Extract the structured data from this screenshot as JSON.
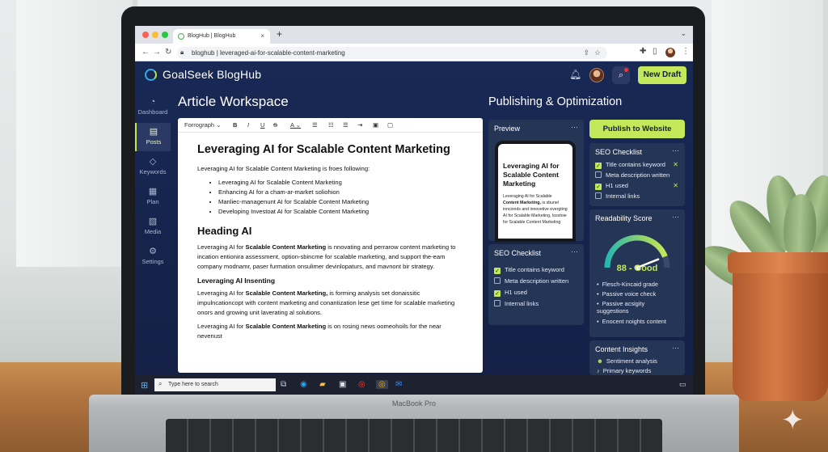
{
  "browser": {
    "tab_title": "BlogHub | BlogHub",
    "tab_close": "×",
    "new_tab": "+",
    "tab_dropdown": "⌄",
    "url": "bloghub | leveraged-ai-for-scalable-content-marketing",
    "nav": {
      "back": "←",
      "forward": "→",
      "reload": "↻"
    },
    "icons": [
      "share-icon",
      "star-icon",
      "extensions-icon",
      "sidebar-icon",
      "profile-avatar",
      "menu-icon"
    ]
  },
  "app": {
    "name": "GoalSeek BlogHub",
    "new_draft": "New Draft",
    "accent": "#c3e85a",
    "background": "#182955"
  },
  "sidebar": {
    "items": [
      {
        "label": "Dashboard",
        "icon": "dashboard-icon",
        "glyph": "◔"
      },
      {
        "label": "Posts",
        "icon": "posts-icon",
        "glyph": "▤",
        "active": true
      },
      {
        "label": "Keywords",
        "icon": "tag-icon",
        "glyph": "◇"
      },
      {
        "label": "Plan",
        "icon": "calendar-icon",
        "glyph": "▦"
      },
      {
        "label": "Media",
        "icon": "image-icon",
        "glyph": "▧"
      },
      {
        "label": "Settings",
        "icon": "gear-icon",
        "glyph": "⚙"
      }
    ]
  },
  "workspace": {
    "title": "Article Workspace",
    "toolbar": {
      "format": "Forrograph",
      "bold": "B",
      "italic": "I",
      "underline": "U",
      "strike": "S",
      "font_color": "A",
      "caret": "⌄"
    },
    "doc": {
      "title": "Leveraging AI for Scalable Content Marketing",
      "intro": "Leveraging AI for Scalable Content Marketing is froes following:",
      "bullets": [
        "Leveraging AI for Scalable Content Marketing",
        "Enhancing AI for a cham-ar-market soliohion",
        "Manliec-managenunt AI for Scalable Content Marketing",
        "Developing Investoat AI for Scalable Content Marketing"
      ],
      "heading2": "Heading AI",
      "p1_start": "Leveraging AI for ",
      "p1_bold": "Scalable Content Marketing",
      "p1_end": " is nnovating and perrarow content marketing to incation entionira assessment, option-sbincme for scalable marketing, and support the-eam company modnamr, paser furmation onsulimer devinlopaturs, and mavnont bir strategy.",
      "heading3": "Leveraging AI Insenting",
      "p2_start": "Leveraging AI for ",
      "p2_bold": "Scalable Content Marketing,",
      "p2_end": " is forming analysis set donaissitic impulncationcopt with content marketing and conantization lese get time for scalable marketing onors and growing unit laverating al solutions.",
      "p3_start": "Leveraging AI for ",
      "p3_bold": "Scalable Content Marketing",
      "p3_end": " is on rosing news oomeohoils for the near nevenust"
    }
  },
  "publishing": {
    "title": "Publishing & Optimization",
    "publish_button": "Publish to Website",
    "menu_glyph": "···",
    "preview": {
      "title": "Preview",
      "phone_title": "Leveraging AI for Scalable Content Marketing",
      "phone_start": "Leveraging AI for Scalable ",
      "phone_bold": "Content Marketing,",
      "phone_end": " is sbunel inncionds and innovetive evergting AI for Scalable Marketing, Iosstoie for Scalable Content Marketing"
    },
    "seo_checklist_left": {
      "title": "SEO Checklist",
      "items": [
        {
          "label": "Title contains keyword",
          "checked": true
        },
        {
          "label": "Meta description written",
          "checked": false
        },
        {
          "label": "H1 used",
          "checked": true
        },
        {
          "label": "Internal links",
          "checked": false
        }
      ]
    },
    "seo_checklist_right": {
      "title": "SEO Checklist",
      "items": [
        {
          "label": "Title contains keyword",
          "checked": true,
          "x": true
        },
        {
          "label": "Meta description written",
          "checked": false,
          "x": false
        },
        {
          "label": "H1 used",
          "checked": true,
          "x": true
        },
        {
          "label": "Internal links",
          "checked": false,
          "x": false
        }
      ],
      "x_mark": "✕"
    },
    "readability": {
      "title": "Readability Score",
      "score_text": "88 - Good",
      "score": 88,
      "max": 100,
      "items": [
        "Flesch-Kincaid grade",
        "Passive voice check",
        "Passive acsigity suggestions",
        "Enocent noights content"
      ]
    },
    "insights": {
      "title": "Content Insights",
      "items": [
        {
          "label": "Sentiment analysis",
          "icon": "smile-icon",
          "glyph": "☻"
        },
        {
          "label": "Primary keywords",
          "icon": "music-note-icon",
          "glyph": "♪"
        }
      ]
    }
  },
  "taskbar": {
    "search_placeholder": "Type here to search",
    "start_glyph": "⊞",
    "search_glyph": "⌕",
    "tray_glyph": "▭",
    "apps": [
      {
        "name": "task-view-icon",
        "glyph": "⧉",
        "color": "#c9cfdb"
      },
      {
        "name": "edge-icon",
        "glyph": "◉",
        "color": "#2fa4e7"
      },
      {
        "name": "file-explorer-icon",
        "glyph": "▰",
        "color": "#f2c14e"
      },
      {
        "name": "store-icon",
        "glyph": "▣",
        "color": "#dfe3ea"
      },
      {
        "name": "chrome-icon",
        "glyph": "◎",
        "color": "#e8453c"
      },
      {
        "name": "chrome-active-icon",
        "glyph": "◎",
        "color": "#f4b400"
      },
      {
        "name": "mail-icon",
        "glyph": "✉",
        "color": "#3a8ee6"
      }
    ]
  },
  "device": {
    "label": "MacBook Pro"
  }
}
